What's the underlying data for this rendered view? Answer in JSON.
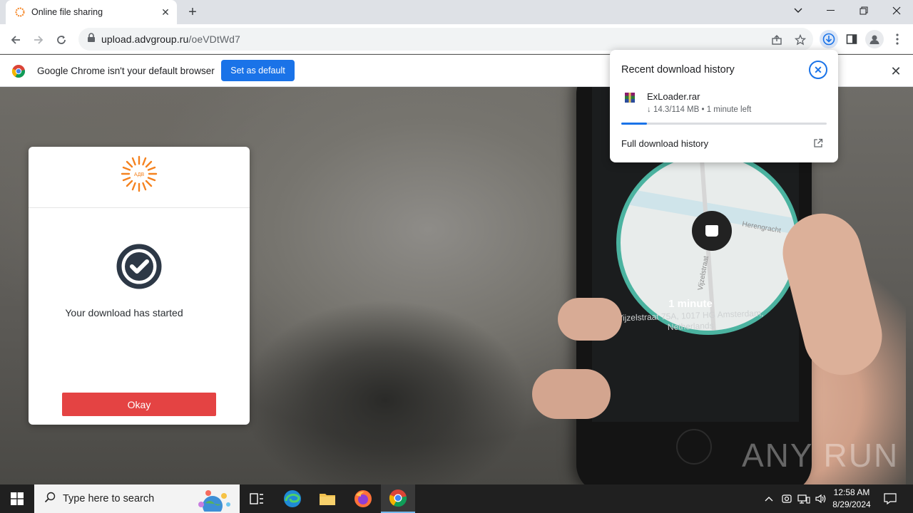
{
  "browser": {
    "tab_title": "Online file sharing",
    "url_domain": "upload.advgroup.ru",
    "url_path": "/oeVDtWd7"
  },
  "infobar": {
    "message": "Google Chrome isn't your default browser",
    "button_label": "Set as default"
  },
  "dialog": {
    "logo_text": "АДВ",
    "message": "Your download has started",
    "button_label": "Okay"
  },
  "background_phone": {
    "eta": "1 minute",
    "address": "Vijzelstraat 75A, 1017 HG Amsterdam, Netherlands",
    "map_labels": [
      "Herengracht",
      "Vijzelstraat",
      "Reguliersg"
    ]
  },
  "download_bubble": {
    "title": "Recent download history",
    "file_name": "ExLoader.rar",
    "file_status": "↓ 14.3/114 MB • 1 minute left",
    "progress_fraction": 0.125,
    "full_history_label": "Full download history"
  },
  "watermark": "ANY RUN",
  "taskbar": {
    "search_placeholder": "Type here to search",
    "time": "12:58 AM",
    "date": "8/29/2024"
  },
  "colors": {
    "accent": "#1a73e8",
    "okay_button": "#e44343",
    "logo_orange": "#f5821f",
    "check_dark": "#2d3846"
  }
}
